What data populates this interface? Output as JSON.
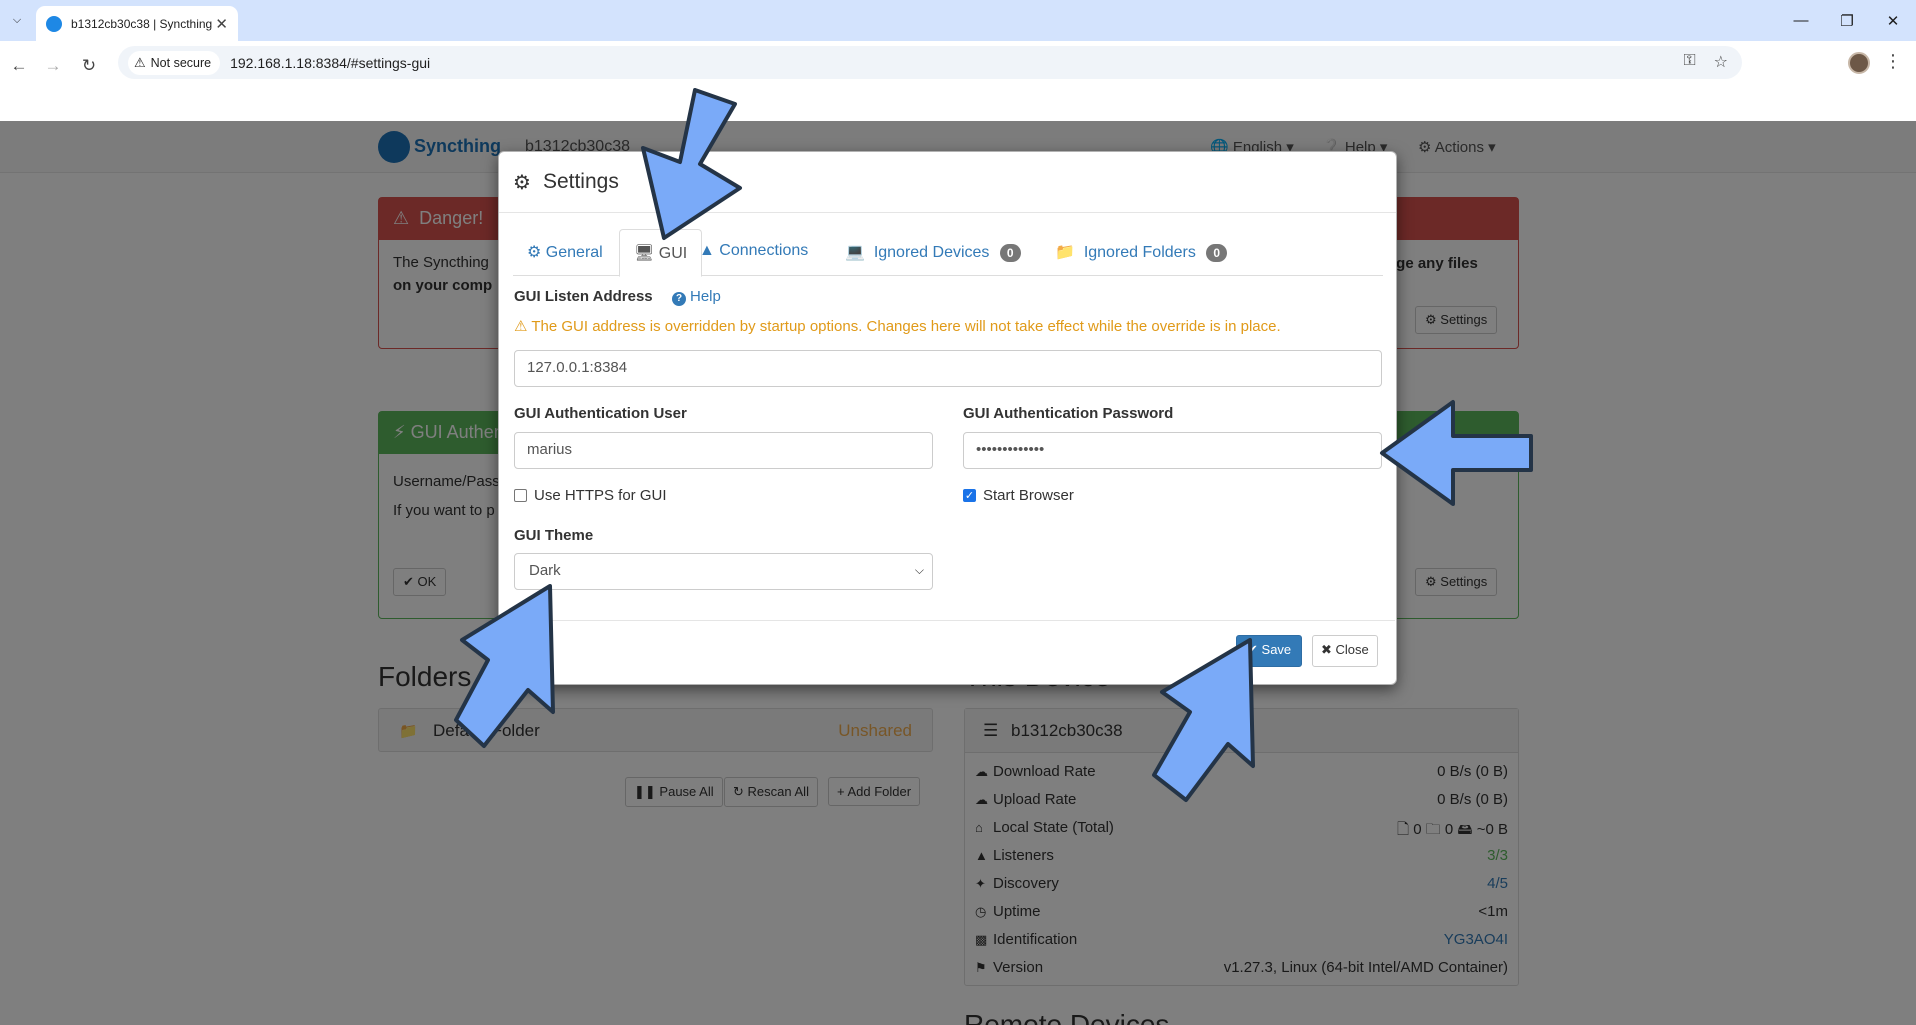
{
  "browser": {
    "tab_title": "b1312cb30c38 | Syncthing",
    "tab_close": "✕",
    "not_secure": "Not secure",
    "url": "192.168.1.18:8384/#settings-gui"
  },
  "page": {
    "brand": "Syncthing",
    "device_name": "b1312cb30c38",
    "nav_language": "English",
    "nav_help": "Help",
    "nav_actions": "Actions",
    "danger_title": "Danger!",
    "danger_text_1": "The Syncthing",
    "danger_text_1b": "nge any files",
    "danger_text_2": "on your comp",
    "danger_settings": "Settings",
    "gui_auth_title": "GUI Authen",
    "gui_auth_text_1": "Username/Pass",
    "gui_auth_text_2": "If you want to p",
    "ok_label": "OK",
    "auth_settings": "Settings",
    "folders_heading": "Folders",
    "this_device_heading": "This Device",
    "remote_devices_heading": "Remote Devices",
    "folder": {
      "name": "Default Folder",
      "status": "Unshared"
    },
    "folder_buttons": {
      "pause_all": "Pause All",
      "rescan_all": "Rescan All",
      "add_folder": "Add Folder"
    },
    "device_panel": {
      "name": "b1312cb30c38",
      "rows": [
        {
          "label": "Download Rate",
          "value": "0 B/s (0 B)"
        },
        {
          "label": "Upload Rate",
          "value": "0 B/s (0 B)"
        },
        {
          "label": "Local State (Total)",
          "value": "🗋 0  🗀 0  🖴 ~0 B"
        },
        {
          "label": "Listeners",
          "value": "3/3"
        },
        {
          "label": "Discovery",
          "value": "4/5"
        },
        {
          "label": "Uptime",
          "value": "<1m"
        },
        {
          "label": "Identification",
          "value": "YG3AO4I"
        },
        {
          "label": "Version",
          "value": "v1.27.3, Linux (64-bit Intel/AMD Container)"
        }
      ]
    }
  },
  "modal": {
    "title": "Settings",
    "tabs": {
      "general": "General",
      "gui": "GUI",
      "connections": "Connections",
      "ignored_devices": "Ignored Devices",
      "ignored_devices_count": "0",
      "ignored_folders": "Ignored Folders",
      "ignored_folders_count": "0"
    },
    "listen_address_label": "GUI Listen Address",
    "help_label": "Help",
    "override_warning": "The GUI address is overridden by startup options. Changes here will not take effect while the override is in place.",
    "listen_address_value": "127.0.0.1:8384",
    "auth_user_label": "GUI Authentication User",
    "auth_user_value": "marius",
    "auth_password_label": "GUI Authentication Password",
    "auth_password_value": "•••••••••••••",
    "use_https_label": "Use HTTPS for GUI",
    "use_https_checked": false,
    "start_browser_label": "Start Browser",
    "start_browser_checked": true,
    "theme_label": "GUI Theme",
    "theme_value": "Dark",
    "save_label": "Save",
    "close_label": "Close"
  },
  "colors": {
    "accent": "#337ab7",
    "danger": "#d9534f",
    "success": "#5cb85c",
    "warning": "#e09a19",
    "annotation_arrow": "#7aaaf8"
  }
}
